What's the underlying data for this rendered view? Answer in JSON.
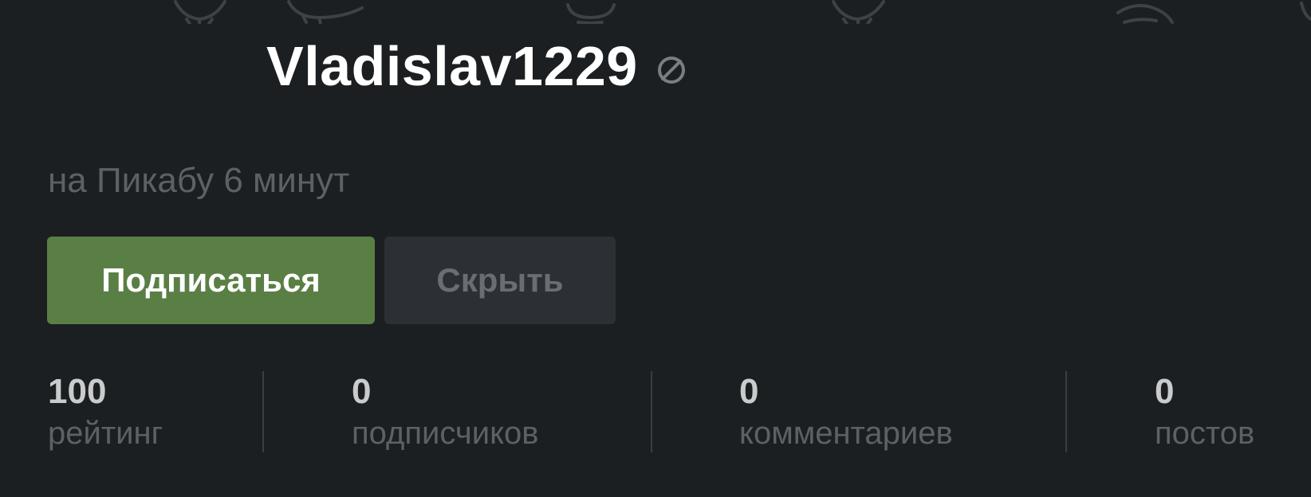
{
  "profile": {
    "username": "Vladislav1229",
    "status_icon": "ignore-icon",
    "membership": "на Пикабу 6 минут"
  },
  "actions": {
    "subscribe_label": "Подписаться",
    "hide_label": "Скрыть"
  },
  "stats": [
    {
      "value": "100",
      "label": "рейтинг"
    },
    {
      "value": "0",
      "label": "подписчиков"
    },
    {
      "value": "0",
      "label": "комментариев"
    },
    {
      "value": "0",
      "label": "постов"
    }
  ],
  "colors": {
    "background": "#1c1f21",
    "subscribe_button": "#5a7f45",
    "hide_button": "#2c3034",
    "muted_text": "#5d6163",
    "divider": "#3a3e41"
  }
}
